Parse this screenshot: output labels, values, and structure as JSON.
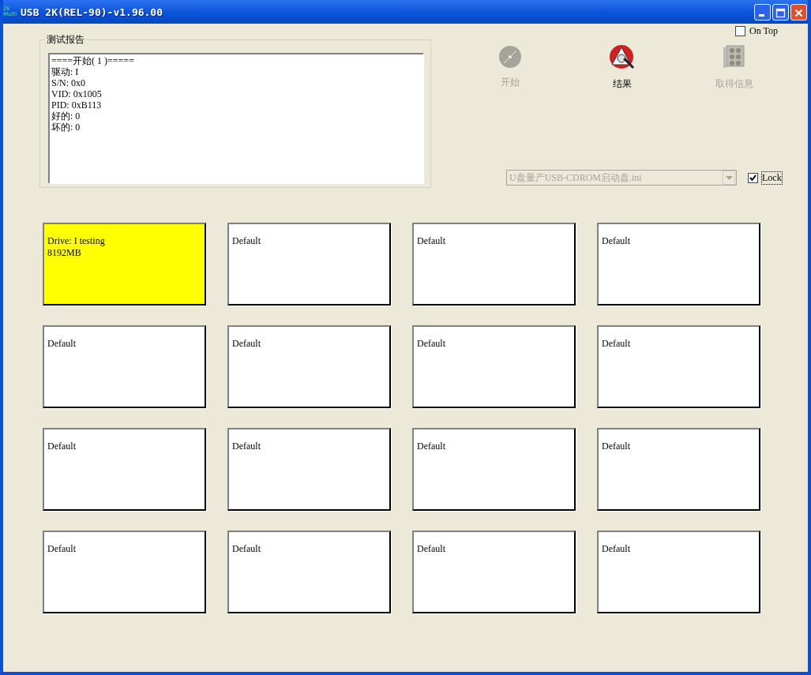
{
  "window": {
    "title": "USB 2K(REL-90)-v1.96.00",
    "app_icon_text": [
      "2k",
      "Multi"
    ]
  },
  "on_top": {
    "label": "On Top",
    "checked": false
  },
  "report": {
    "title": "测试报告",
    "lines": [
      "====开始( 1 )=====",
      "驱动: I",
      "S/N: 0x0",
      "VID: 0x1005",
      "PID: 0xB113",
      "好的: 0",
      "坏的: 0"
    ]
  },
  "toolbar": [
    {
      "kind": "disc",
      "label": "开始",
      "disabled": true
    },
    {
      "kind": "result",
      "label": "结果",
      "disabled": false
    },
    {
      "kind": "info",
      "label": "取得信息",
      "disabled": true
    }
  ],
  "config": {
    "value": "U盘量产USB-CDROM启动盘.ini",
    "disabled": true
  },
  "lock": {
    "label": "Lock",
    "checked": true
  },
  "slots": [
    {
      "lines": [
        "Drive: I  testing",
        "8192MB"
      ],
      "color": "#ffff00"
    },
    {
      "lines": [
        "Default"
      ],
      "color": "#ffffff"
    },
    {
      "lines": [
        "Default"
      ],
      "color": "#ffffff"
    },
    {
      "lines": [
        "Default"
      ],
      "color": "#ffffff"
    },
    {
      "lines": [
        "Default"
      ],
      "color": "#ffffff"
    },
    {
      "lines": [
        "Default"
      ],
      "color": "#ffffff"
    },
    {
      "lines": [
        "Default"
      ],
      "color": "#ffffff"
    },
    {
      "lines": [
        "Default"
      ],
      "color": "#ffffff"
    },
    {
      "lines": [
        "Default"
      ],
      "color": "#ffffff"
    },
    {
      "lines": [
        "Default"
      ],
      "color": "#ffffff"
    },
    {
      "lines": [
        "Default"
      ],
      "color": "#ffffff"
    },
    {
      "lines": [
        "Default"
      ],
      "color": "#ffffff"
    },
    {
      "lines": [
        "Default"
      ],
      "color": "#ffffff"
    },
    {
      "lines": [
        "Default"
      ],
      "color": "#ffffff"
    },
    {
      "lines": [
        "Default"
      ],
      "color": "#ffffff"
    },
    {
      "lines": [
        "Default"
      ],
      "color": "#ffffff"
    }
  ]
}
